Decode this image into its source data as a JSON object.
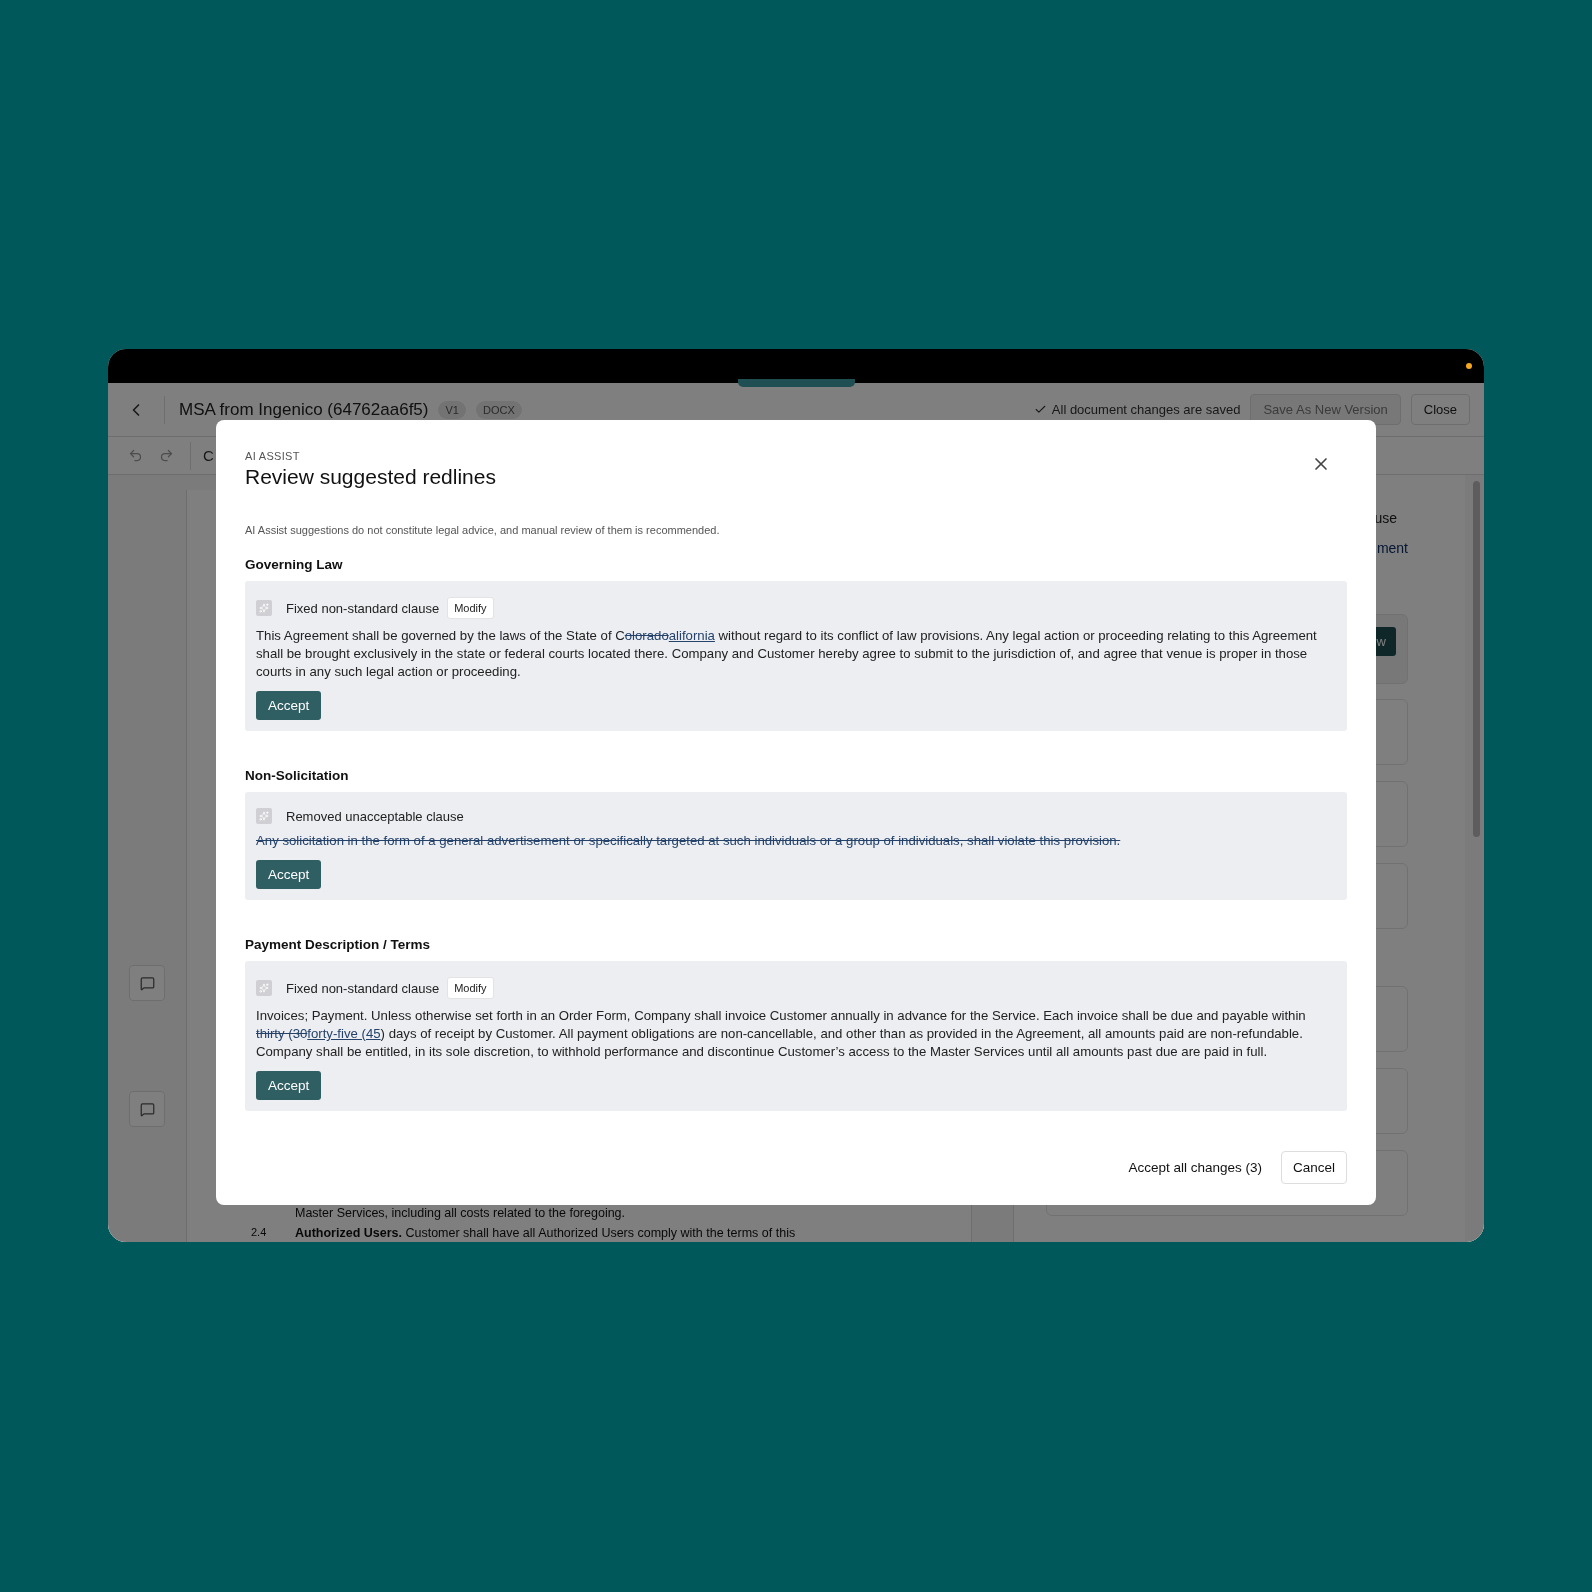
{
  "window": {
    "title": "MSA from Ingenico (64762aa6f5)",
    "badges": [
      "V1",
      "DOCX"
    ],
    "save_status": "All document changes are saved",
    "save_button": {
      "label": "Save As New Version",
      "disabled": true
    },
    "close_button": "Close"
  },
  "toolbar": {
    "text": "C"
  },
  "document": {
    "lines": [
      {
        "kind": "text",
        "text": "Master Services, including all costs related to the foregoing."
      },
      {
        "kind": "section",
        "number": "2.4",
        "heading": "Authorized Users.",
        "text": "Customer shall have all Authorized Users comply with the terms of this"
      }
    ]
  },
  "side_panel": {
    "label": "use",
    "link": "ment",
    "button": "w"
  },
  "modal": {
    "eyebrow": "AI ASSIST",
    "title": "Review suggested redlines",
    "disclaimer": "AI Assist suggestions do not constitute legal advice, and manual review of them is recommended.",
    "sections": [
      {
        "heading": "Governing Law",
        "status": "Fixed non-standard clause",
        "modify": "Modify",
        "accept": "Accept",
        "segments": [
          {
            "kind": "text",
            "text": "This Agreement shall be governed by the laws of the State of C"
          },
          {
            "kind": "deleted",
            "text": "olorado"
          },
          {
            "kind": "inserted",
            "text": "alifornia"
          },
          {
            "kind": "text",
            "text": " without regard to its conflict of law provisions. Any legal action or proceeding relating to this Agreement shall be brought exclusively in the state or federal courts located there. Company and Customer hereby agree to submit to the jurisdiction of, and agree that venue is proper in those courts in any such legal action or proceeding."
          }
        ]
      },
      {
        "heading": "Non-Solicitation",
        "status": "Removed unacceptable clause",
        "accept": "Accept",
        "segments": [
          {
            "kind": "deleted",
            "text": "Any solicitation in the form of a general advertisement or specifically targeted at such individuals or a group of individuals, shall violate this provision."
          }
        ]
      },
      {
        "heading": "Payment Description / Terms",
        "status": "Fixed non-standard clause",
        "modify": "Modify",
        "accept": "Accept",
        "segments": [
          {
            "kind": "text",
            "text": "Invoices; Payment. Unless otherwise set forth in an Order Form, Company shall invoice Customer annually in advance for the Service. Each invoice shall be due and payable within "
          },
          {
            "kind": "deleted",
            "text": "thirty (30"
          },
          {
            "kind": "inserted",
            "text": "forty-five (45"
          },
          {
            "kind": "text",
            "text": ") days of receipt by Customer. All payment obligations are non-cancellable, and other than as provided in the Agreement, all amounts paid are non-refundable. Company shall be entitled, in its sole discretion, to withhold performance and discontinue Customer’s access to the Master Services until all amounts past due are paid in full."
          }
        ]
      }
    ],
    "accept_all": "Accept all changes (3)",
    "cancel": "Cancel"
  }
}
